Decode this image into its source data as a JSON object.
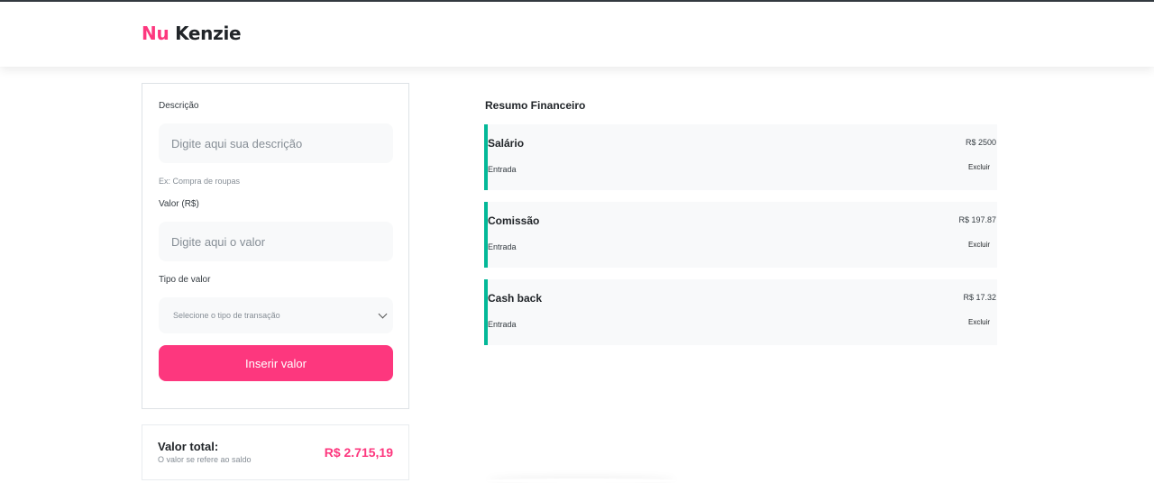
{
  "header": {
    "logo_nu": "Nu",
    "logo_kenzie": "Kenzie"
  },
  "form": {
    "description_label": "Descrição",
    "description_placeholder": "Digite aqui sua descrição",
    "description_hint": "Ex: Compra de roupas",
    "value_label": "Valor (R$)",
    "value_placeholder": "Digite aqui o valor",
    "type_label": "Tipo de valor",
    "type_selected": "Selecione o tipo de transação",
    "submit_label": "Inserir valor"
  },
  "total": {
    "title": "Valor total:",
    "subtitle": "O valor se refere ao saldo",
    "value": "R$ 2.715,19"
  },
  "summary": {
    "title": "Resumo Financeiro",
    "items": [
      {
        "name": "Salário",
        "type": "Entrada",
        "value": "R$ 2500",
        "delete_label": "Excluir"
      },
      {
        "name": "Comissão",
        "type": "Entrada",
        "value": "R$ 197.87",
        "delete_label": "Excluir"
      },
      {
        "name": "Cash back",
        "type": "Entrada",
        "value": "R$ 17.32",
        "delete_label": "Excluir"
      }
    ]
  },
  "colors": {
    "brand": "#fd377e",
    "entry_accent": "#03b898",
    "surface": "#f8f9fa"
  },
  "icons": {
    "select": "chevron-down-icon"
  }
}
